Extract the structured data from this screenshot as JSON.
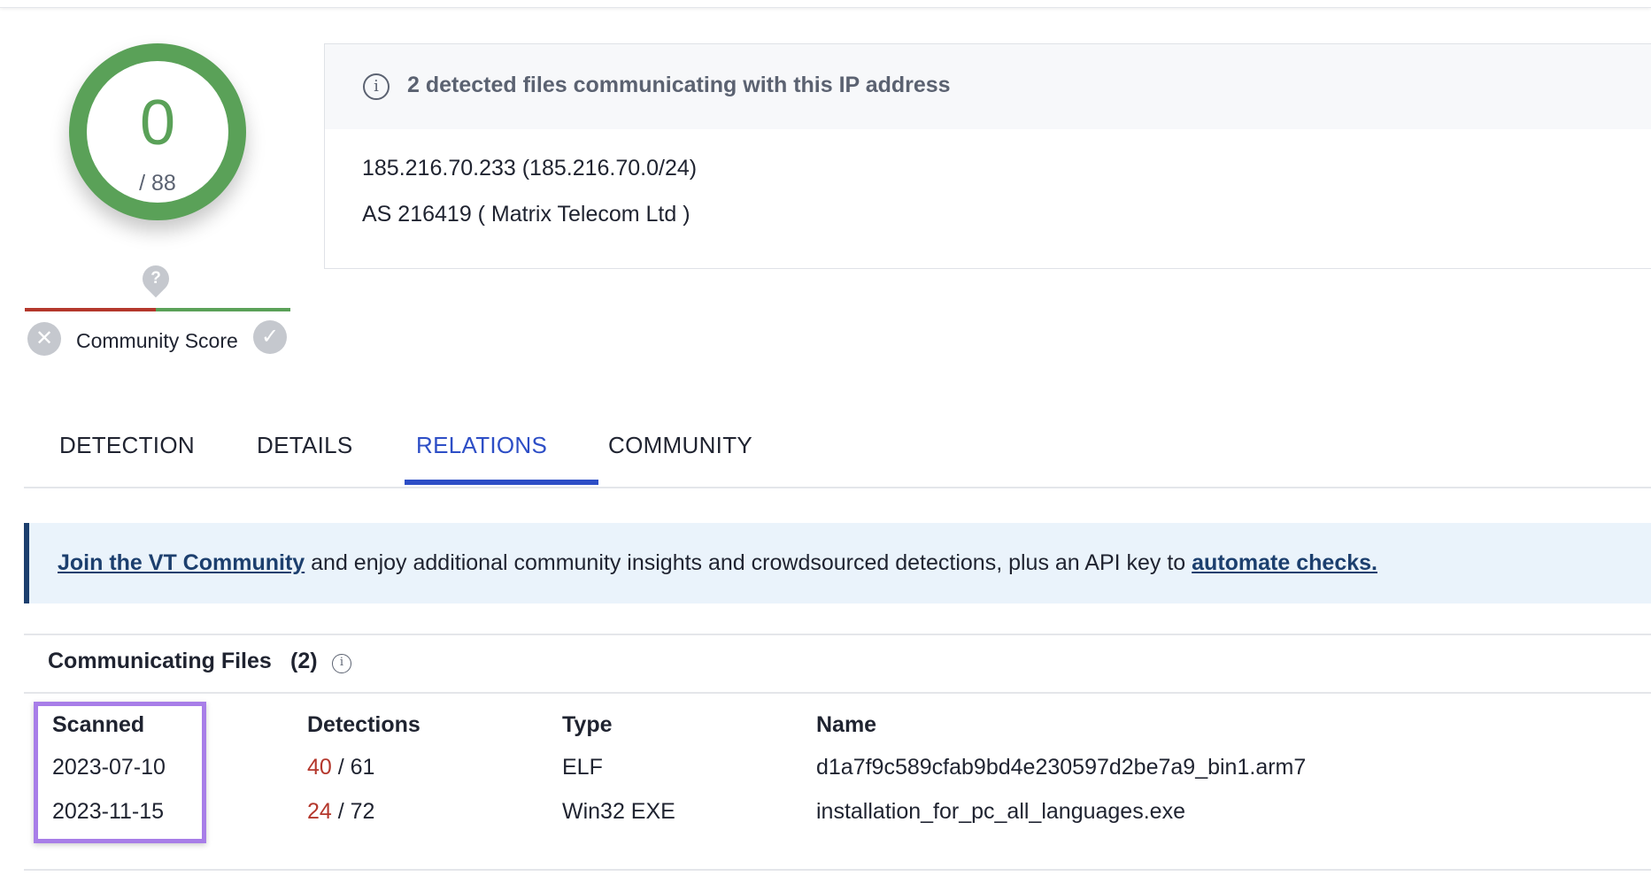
{
  "score": {
    "detections": "0",
    "total": "/ 88"
  },
  "community": {
    "pin_icon": "question-mark",
    "label": "Community Score",
    "reject_icon": "x",
    "accept_icon": "check",
    "bar_colors": {
      "negative": "#b4372c",
      "positive": "#5aa158"
    }
  },
  "info_card": {
    "header": "2 detected files communicating with this IP address",
    "ip_line": "185.216.70.233  (185.216.70.0/24)",
    "as_line": "AS 216419  ( Matrix Telecom Ltd )"
  },
  "tabs": [
    {
      "label": "DETECTION",
      "active": false
    },
    {
      "label": "DETAILS",
      "active": false
    },
    {
      "label": "RELATIONS",
      "active": true
    },
    {
      "label": "COMMUNITY",
      "active": false
    }
  ],
  "banner": {
    "link1": "Join the VT Community",
    "middle": " and enjoy additional community insights and crowdsourced detections, plus an API key to ",
    "link2": "automate checks."
  },
  "communicating_files": {
    "title": "Communicating Files",
    "count": "(2)",
    "columns": [
      "Scanned",
      "Detections",
      "Type",
      "Name"
    ],
    "rows": [
      {
        "scanned": "2023-07-10",
        "positives": "40",
        "total": " / 61",
        "type": "ELF",
        "name": "d1a7f9c589cfab9bd4e230597d2be7a9_bin1.arm7"
      },
      {
        "scanned": "2023-11-15",
        "positives": "24",
        "total": " / 72",
        "type": "Win32 EXE",
        "name": "installation_for_pc_all_languages.exe"
      }
    ]
  },
  "colors": {
    "accent": "#2d4ec6",
    "safe": "#5aa158",
    "malicious": "#b4372c",
    "highlight": "#a87ee8"
  }
}
